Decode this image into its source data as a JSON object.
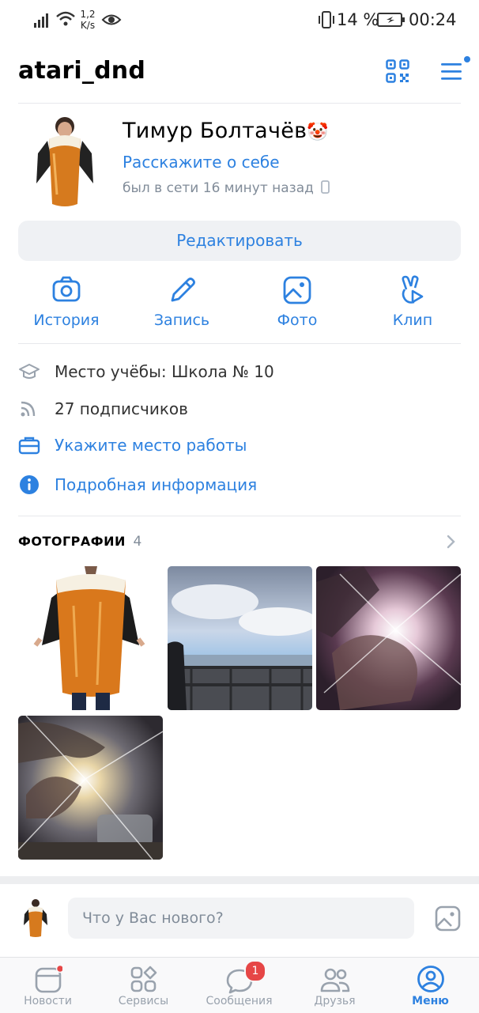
{
  "status_bar": {
    "speed_value": "1,2",
    "speed_unit": "K/s",
    "battery_percent": "14 %",
    "time": "00:24"
  },
  "header": {
    "username": "atari_dnd"
  },
  "profile": {
    "name": "Тимур Болтачёв",
    "emoji": "🤡",
    "about_link": "Расскажите о себе",
    "last_seen": "был в сети 16 минут назад",
    "edit_button": "Редактировать"
  },
  "actions": [
    {
      "label": "История",
      "icon": "camera-icon"
    },
    {
      "label": "Запись",
      "icon": "pencil-icon"
    },
    {
      "label": "Фото",
      "icon": "image-icon"
    },
    {
      "label": "Клип",
      "icon": "clip-icon"
    }
  ],
  "info": {
    "education": "Место учёбы: Школа № 10",
    "followers": "27 подписчиков",
    "work_link": "Укажите место работы",
    "details_link": "Подробная информация"
  },
  "photos": {
    "title": "ФОТОГРАФИИ",
    "count": "4"
  },
  "composer": {
    "placeholder": "Что у Вас нового?"
  },
  "tabbar": {
    "tabs": [
      {
        "label": "Новости",
        "icon": "news-icon",
        "dot": true
      },
      {
        "label": "Сервисы",
        "icon": "services-icon"
      },
      {
        "label": "Сообщения",
        "icon": "messages-icon",
        "badge": "1"
      },
      {
        "label": "Друзья",
        "icon": "friends-icon"
      },
      {
        "label": "Меню",
        "icon": "profile-icon",
        "active": true
      }
    ]
  },
  "colors": {
    "accent": "#2d81e0",
    "badge": "#e64646",
    "secondary_text": "#818c99"
  }
}
